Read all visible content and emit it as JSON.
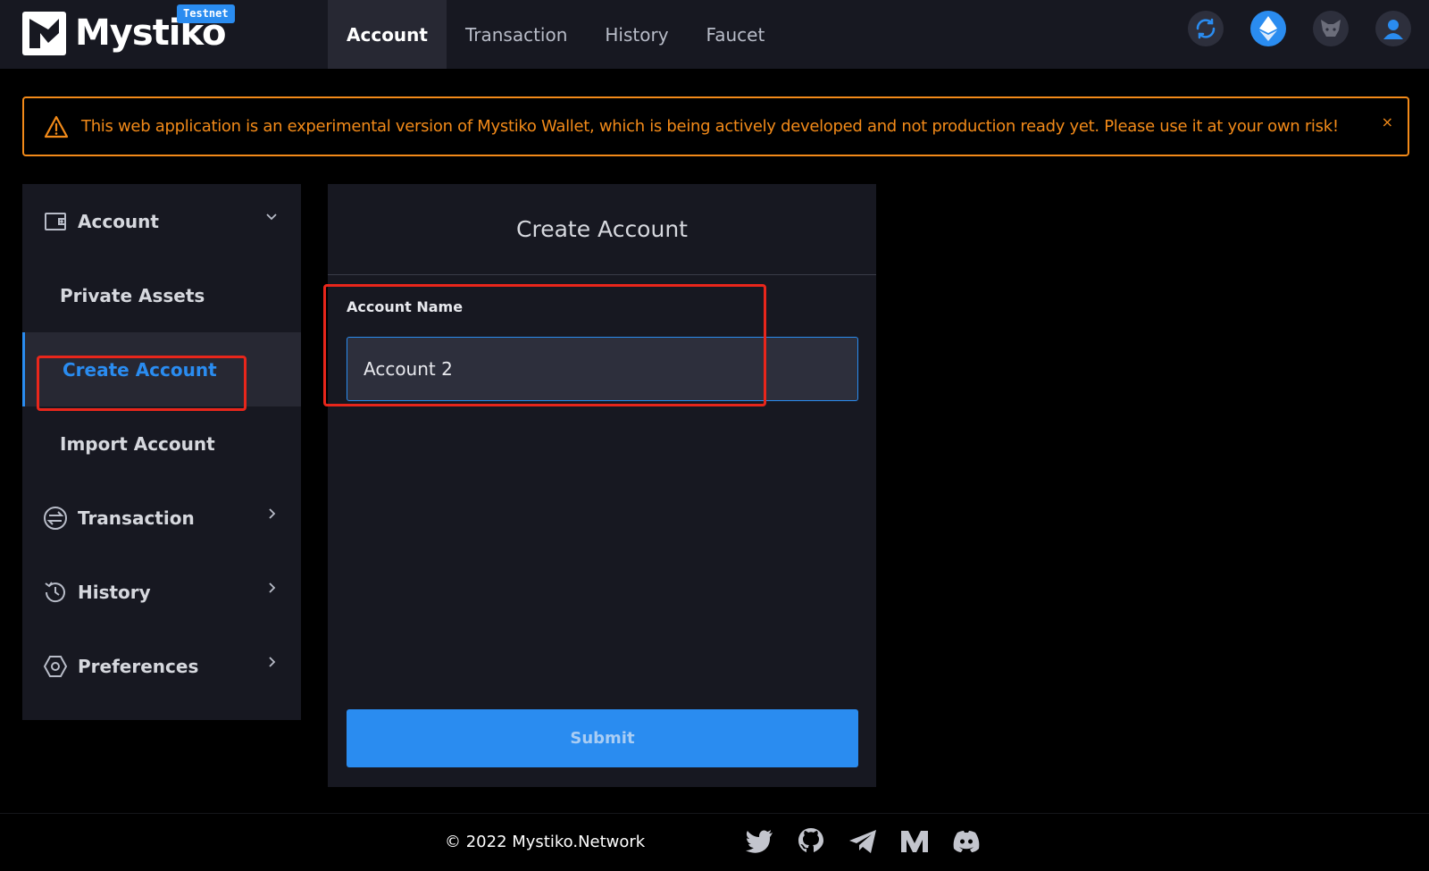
{
  "header": {
    "logo_text": "Mystiko",
    "badge": "Testnet",
    "nav": [
      {
        "label": "Account",
        "active": true
      },
      {
        "label": "Transaction",
        "active": false
      },
      {
        "label": "History",
        "active": false
      },
      {
        "label": "Faucet",
        "active": false
      }
    ],
    "icons": [
      "refresh-icon",
      "ethereum-icon",
      "metamask-icon",
      "user-icon"
    ]
  },
  "alert": {
    "text": "This web application is an experimental version of Mystiko Wallet, which is being actively developed and not production ready yet. Please use it at your own risk!",
    "close": "×"
  },
  "sidebar": {
    "account": {
      "label": "Account",
      "icon": "wallet-icon"
    },
    "sub_items": [
      {
        "label": "Private Assets",
        "active": false
      },
      {
        "label": "Create Account",
        "active": true
      },
      {
        "label": "Import Account",
        "active": false
      }
    ],
    "sections": [
      {
        "label": "Transaction",
        "icon": "transfer-icon"
      },
      {
        "label": "History",
        "icon": "history-icon"
      },
      {
        "label": "Preferences",
        "icon": "settings-icon"
      }
    ]
  },
  "main": {
    "title": "Create Account",
    "field_label": "Account Name",
    "field_value": "Account 2",
    "submit_label": "Submit"
  },
  "footer": {
    "copyright": "© 2022 Mystiko.Network",
    "socials": [
      "twitter-icon",
      "github-icon",
      "telegram-icon",
      "medium-icon",
      "discord-icon"
    ]
  },
  "colors": {
    "accent": "#2a8cf0",
    "warning": "#f28a19",
    "highlight": "#e8261b",
    "panel": "#171821"
  }
}
